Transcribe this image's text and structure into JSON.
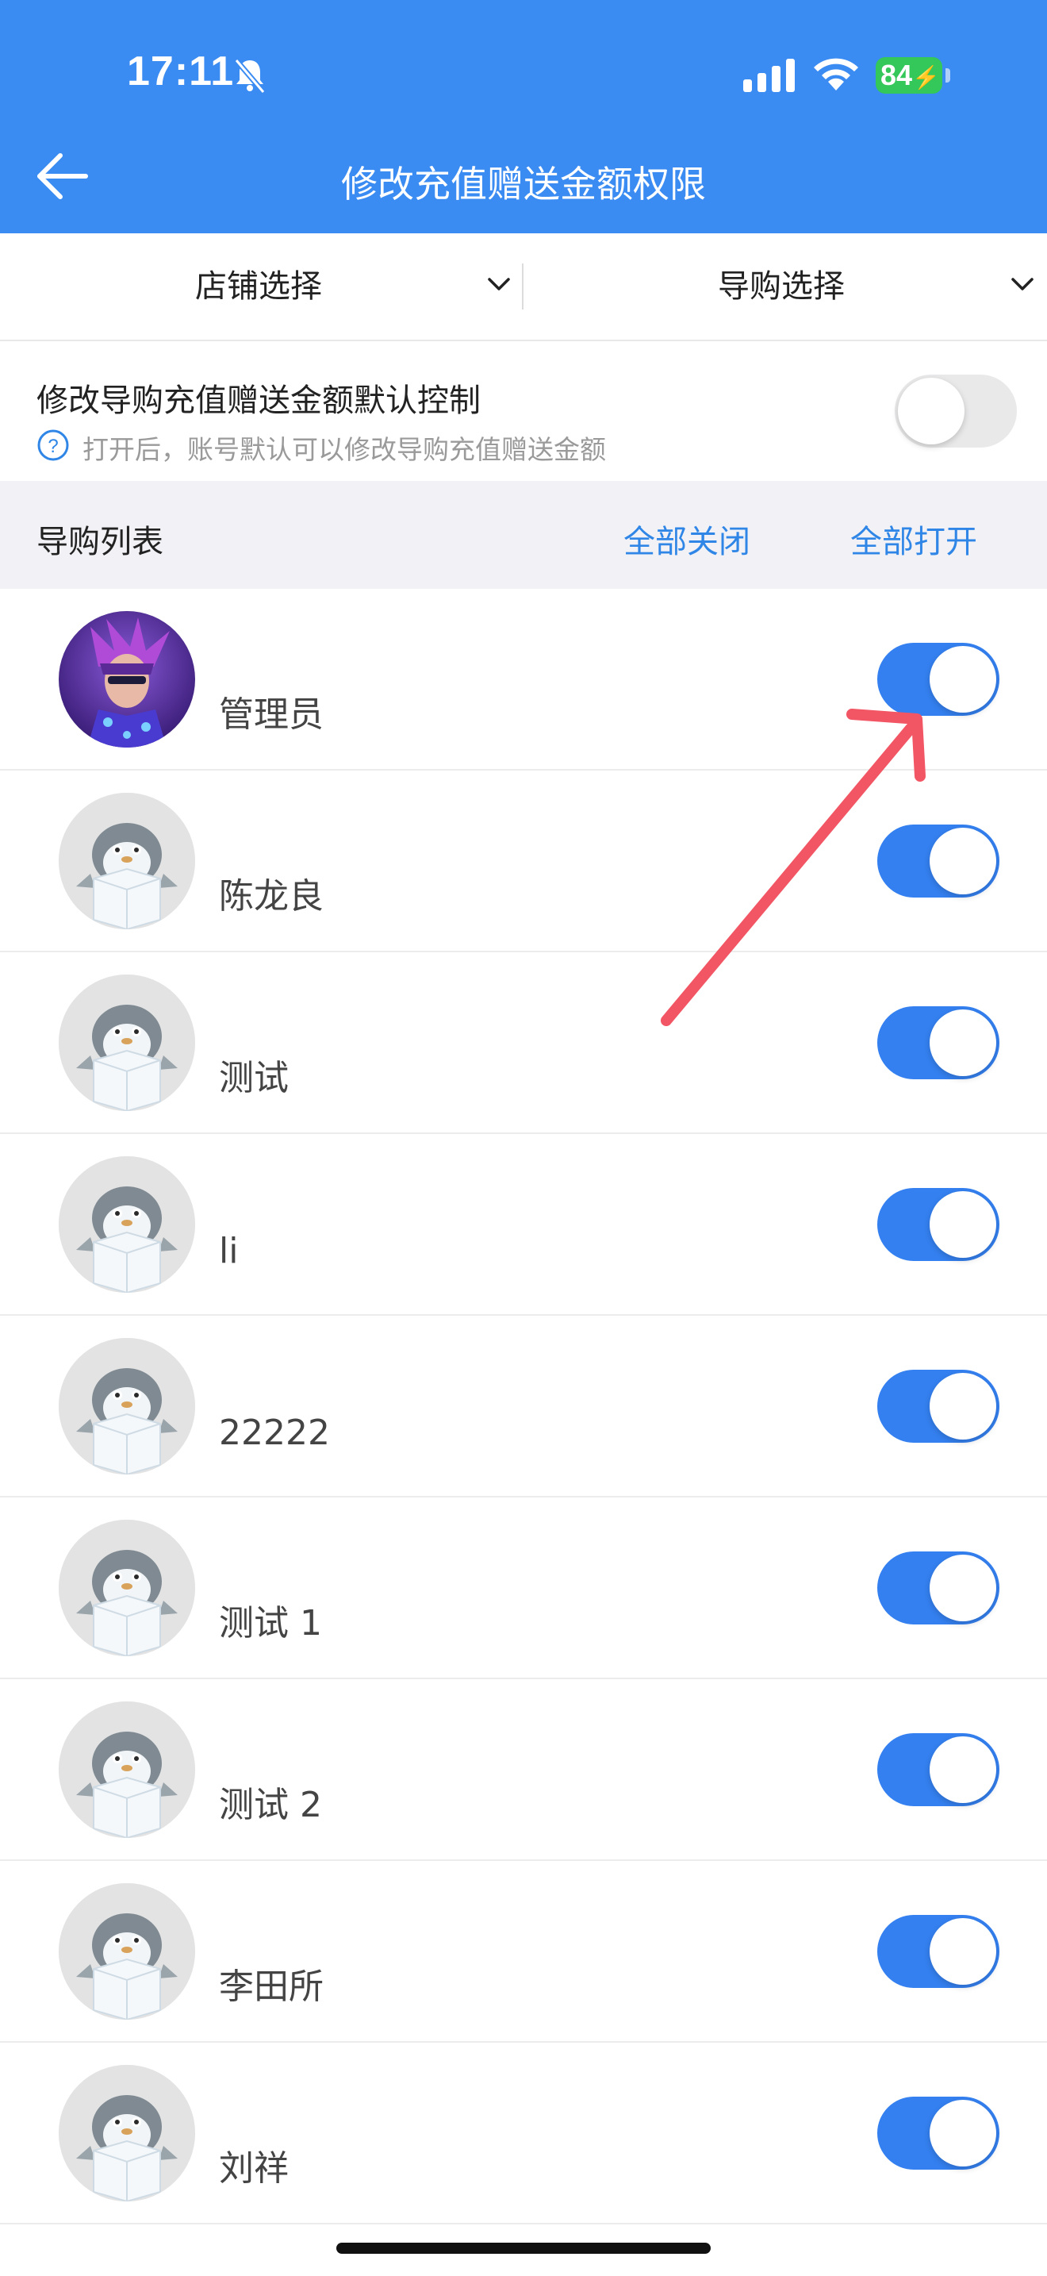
{
  "status": {
    "time": "17:11",
    "battery": "84"
  },
  "header": {
    "title": "修改充值赠送金额权限"
  },
  "filters": {
    "store": "店铺选择",
    "guide": "导购选择"
  },
  "setting": {
    "title": "修改导购充值赠送金额默认控制",
    "hint": "打开后，账号默认可以修改导购充值赠送金额",
    "enabled": false
  },
  "list_header": {
    "title": "导购列表",
    "close_all": "全部关闭",
    "open_all": "全部打开"
  },
  "guides": [
    {
      "name": "管理员",
      "avatar": "character-avatar",
      "enabled": true
    },
    {
      "name": "陈龙良",
      "avatar": "penguin-avatar",
      "enabled": true
    },
    {
      "name": "测试",
      "avatar": "penguin-avatar",
      "enabled": true
    },
    {
      "name": "li",
      "avatar": "penguin-avatar",
      "enabled": true
    },
    {
      "name": "22222",
      "avatar": "penguin-avatar",
      "enabled": true
    },
    {
      "name": "测试 1",
      "avatar": "penguin-avatar",
      "enabled": true
    },
    {
      "name": "测试 2",
      "avatar": "penguin-avatar",
      "enabled": true
    },
    {
      "name": "李田所",
      "avatar": "penguin-avatar",
      "enabled": true
    },
    {
      "name": "刘祥",
      "avatar": "penguin-avatar",
      "enabled": true
    }
  ],
  "colors": {
    "header": "#3a8bf2",
    "toggle_on": "#3480f0",
    "link": "#2f86e6",
    "annotation_arrow": "#f25563"
  }
}
